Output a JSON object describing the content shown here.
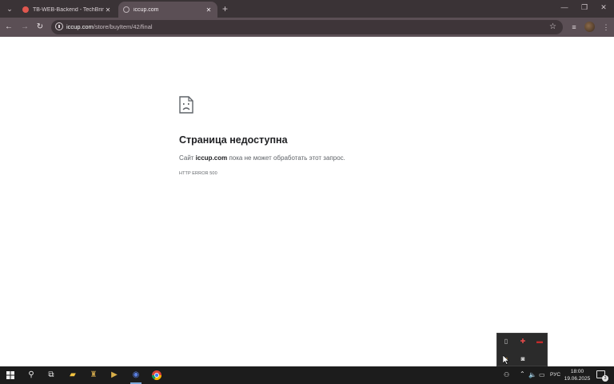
{
  "browser": {
    "tabs": [
      {
        "title": "TB-WEB-Backend - TechBringe",
        "close": "✕"
      },
      {
        "title": "iccup.com",
        "close": "✕"
      }
    ],
    "new_tab": "+",
    "window_controls": {
      "minimize": "—",
      "restore": "❐",
      "close": "✕"
    },
    "nav": {
      "back": "←",
      "forward": "→",
      "reload": "↻"
    },
    "address": {
      "host": "iccup.com",
      "path": "/store/buyItem/42/final"
    },
    "colors": {
      "tabbar": "#3a3336",
      "toolbar": "#5b4f55"
    }
  },
  "error_page": {
    "title": "Страница недоступна",
    "desc_prefix": "Сайт ",
    "desc_host": "iccup.com",
    "desc_suffix": " пока не может обработать этот запрос.",
    "code": "HTTP ERROR 500"
  },
  "taskbar": {
    "language": "РУС",
    "time": "18:00",
    "date": "19.06.2025",
    "notifications_count": "3"
  }
}
